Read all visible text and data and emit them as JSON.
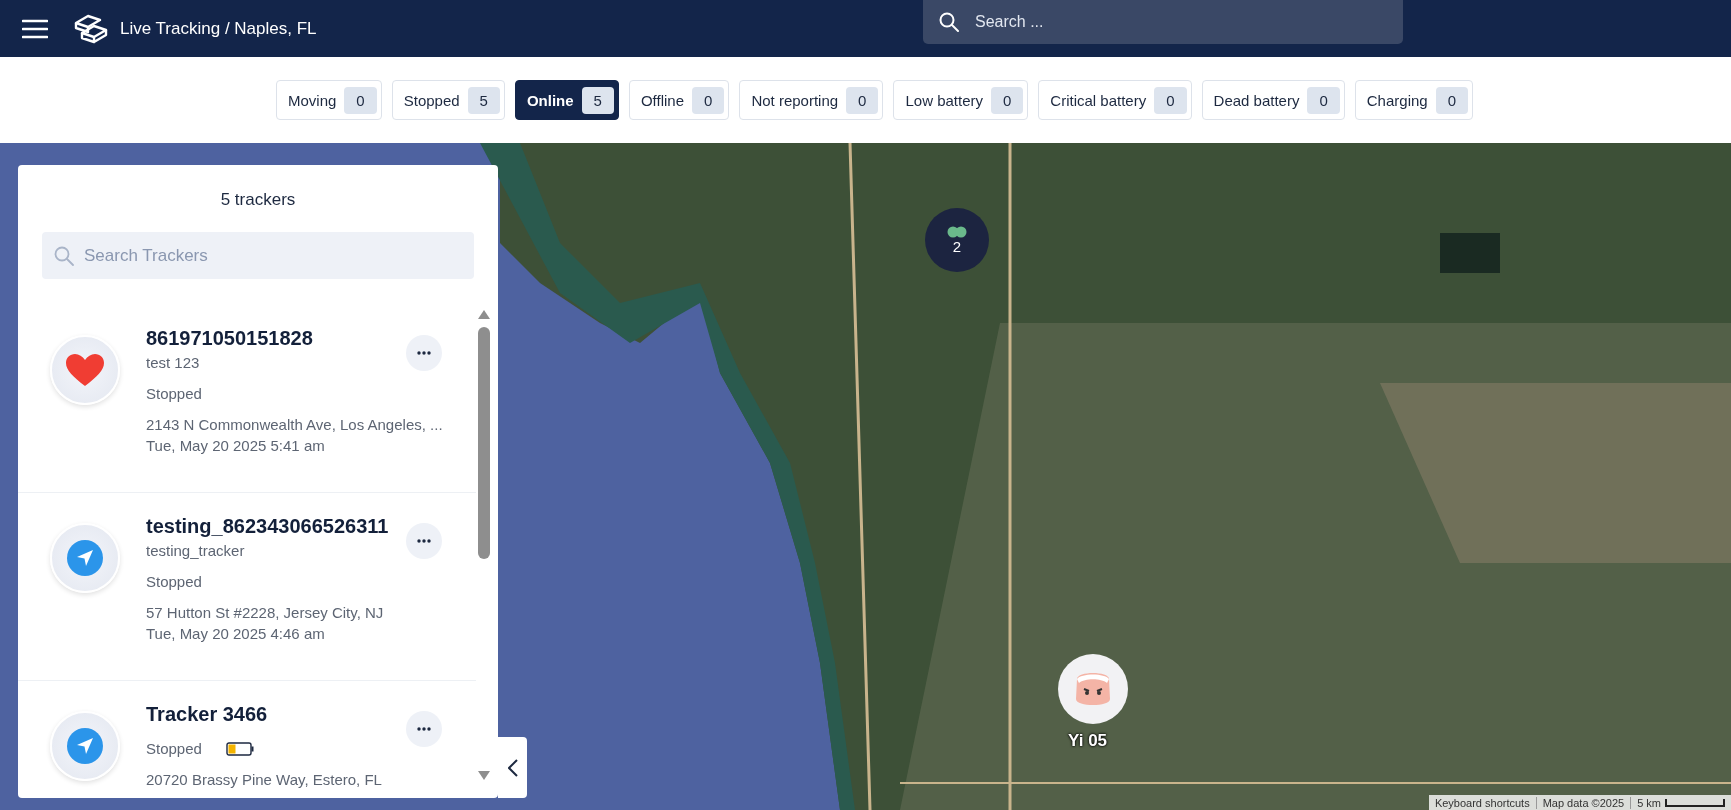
{
  "header": {
    "title": "Live Tracking / Naples, FL",
    "search": {
      "placeholder": "Search ..."
    }
  },
  "filters": [
    {
      "label": "Moving",
      "count": "0",
      "selected": false
    },
    {
      "label": "Stopped",
      "count": "5",
      "selected": false
    },
    {
      "label": "Online",
      "count": "5",
      "selected": true
    },
    {
      "label": "Offline",
      "count": "0",
      "selected": false
    },
    {
      "label": "Not reporting",
      "count": "0",
      "selected": false
    },
    {
      "label": "Low battery",
      "count": "0",
      "selected": false
    },
    {
      "label": "Critical battery",
      "count": "0",
      "selected": false
    },
    {
      "label": "Dead battery",
      "count": "0",
      "selected": false
    },
    {
      "label": "Charging",
      "count": "0",
      "selected": false
    }
  ],
  "panel": {
    "title": "5 trackers",
    "search": {
      "placeholder": "Search Trackers"
    },
    "trackers": [
      {
        "kind": "heart",
        "name": "861971050151828",
        "subtitle": "test 123",
        "status": "Stopped",
        "address": "2143 N Commonwealth Ave, Los Angeles, ...",
        "time": "Tue, May 20 2025 5:41 am"
      },
      {
        "kind": "navigation",
        "name": "testing_862343066526311",
        "subtitle": "testing_tracker",
        "status": "Stopped",
        "address": "57 Hutton St #2228, Jersey City, NJ",
        "time": "Tue, May 20 2025 4:46 am"
      },
      {
        "kind": "navigation",
        "name": "Tracker 3466",
        "status": "Stopped",
        "battery": {
          "level": 0.3
        },
        "address": "20720 Brassy Pine Way, Estero, FL"
      }
    ]
  },
  "map": {
    "cluster": {
      "count": "2"
    },
    "marker": {
      "label": "Yi 05"
    },
    "attribution": [
      "Keyboard shortcuts",
      "Map data ©2025"
    ],
    "scale": "5 km"
  }
}
